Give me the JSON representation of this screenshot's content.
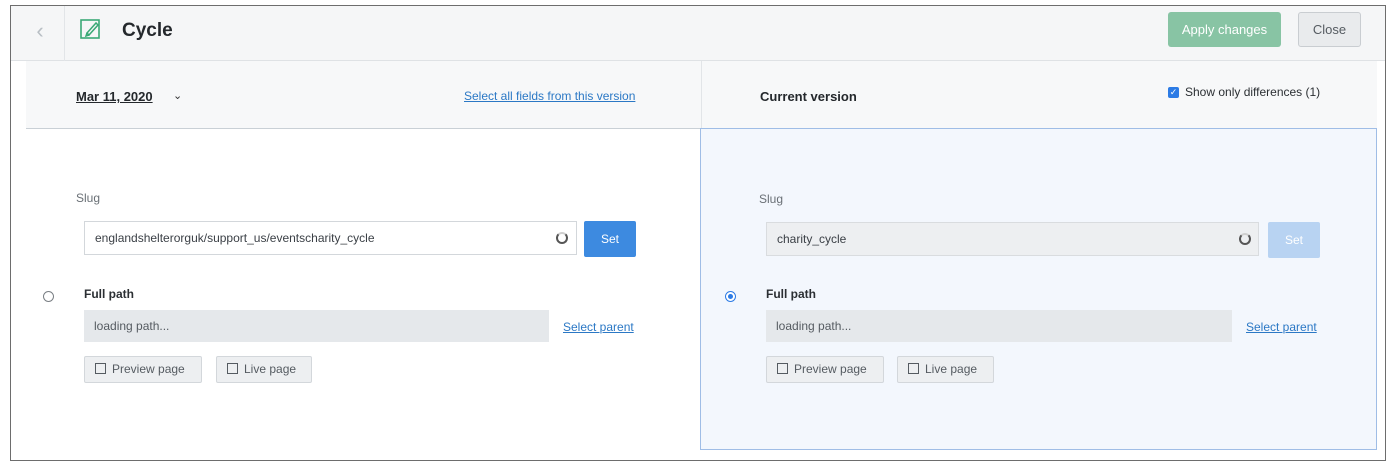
{
  "header": {
    "back_icon": "chevron-left-icon",
    "title_icon": "edit-page-icon",
    "title": "Cycle",
    "apply_label": "Apply changes",
    "close_label": "Close"
  },
  "left": {
    "version_date": "Mar 11, 2020",
    "select_all_label": "Select all fields from this version",
    "slug_label": "Slug",
    "slug_value": "englandshelterorguk/support_us/eventscharity_cycle",
    "set_label": "Set",
    "full_path_label": "Full path",
    "path_value": "loading path...",
    "select_parent_label": "Select parent",
    "preview_label": "Preview page",
    "live_label": "Live page",
    "selected": false
  },
  "right": {
    "version_label": "Current version",
    "show_diff_label": "Show only differences (1)",
    "show_diff_checked": true,
    "slug_label": "Slug",
    "slug_value": "charity_cycle",
    "set_label": "Set",
    "full_path_label": "Full path",
    "path_value": "loading path...",
    "select_parent_label": "Select parent",
    "preview_label": "Preview page",
    "live_label": "Live page",
    "selected": true
  },
  "colors": {
    "apply_green": "#88c4a4",
    "set_blue": "#3d8ae0",
    "link_blue": "#2b78c5",
    "selected_panel_bg": "#f3f7fd"
  }
}
